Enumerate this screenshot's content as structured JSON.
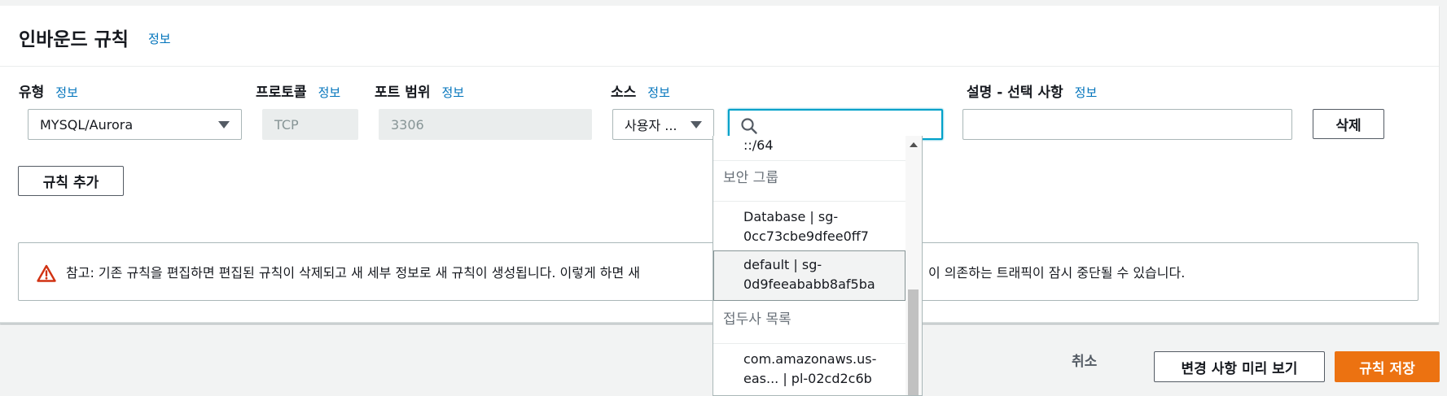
{
  "panel": {
    "title": "인바운드 규칙",
    "info": "정보"
  },
  "columns": {
    "type": {
      "label": "유형",
      "info": "정보"
    },
    "protocol": {
      "label": "프로토콜",
      "info": "정보"
    },
    "port_range": {
      "label": "포트 범위",
      "info": "정보"
    },
    "source": {
      "label": "소스",
      "info": "정보"
    },
    "description": {
      "label": "설명 - 선택 사항",
      "info": "정보"
    }
  },
  "rule": {
    "type_value": "MYSQL/Aurora",
    "protocol_value": "TCP",
    "port_value": "3306",
    "source_type_value": "사용자 ...",
    "search_value": "",
    "description_value": "",
    "delete_label": "삭제"
  },
  "add_rule_label": "규칙 추가",
  "alert": {
    "text": "참고: 기존 규칙을 편집하면 편집된 규칙이 삭제되고 새 세부 정보로 새 규칙이 생성됩니다. 이렇게 하면 새",
    "text_right": "이 의존하는 트래픽이 잠시 중단될 수 있습니다."
  },
  "dropdown": {
    "cidr_partial": "::/64",
    "security_group_header": "보안 그룹",
    "sg_items": [
      {
        "line1": "Database | sg-",
        "line2": "0cc73cbe9dfee0ff7"
      },
      {
        "line1": "default | sg-",
        "line2": "0d9feeababb8af5ba"
      }
    ],
    "prefix_list_header": "접두사 목록",
    "prefix_items": [
      {
        "line1": "com.amazonaws.us-",
        "line2": "eas... | pl-02cd2c6b"
      }
    ]
  },
  "footer": {
    "cancel_label": "취소",
    "preview_label": "변경 사항 미리 보기",
    "save_label": "규칙 저장"
  }
}
